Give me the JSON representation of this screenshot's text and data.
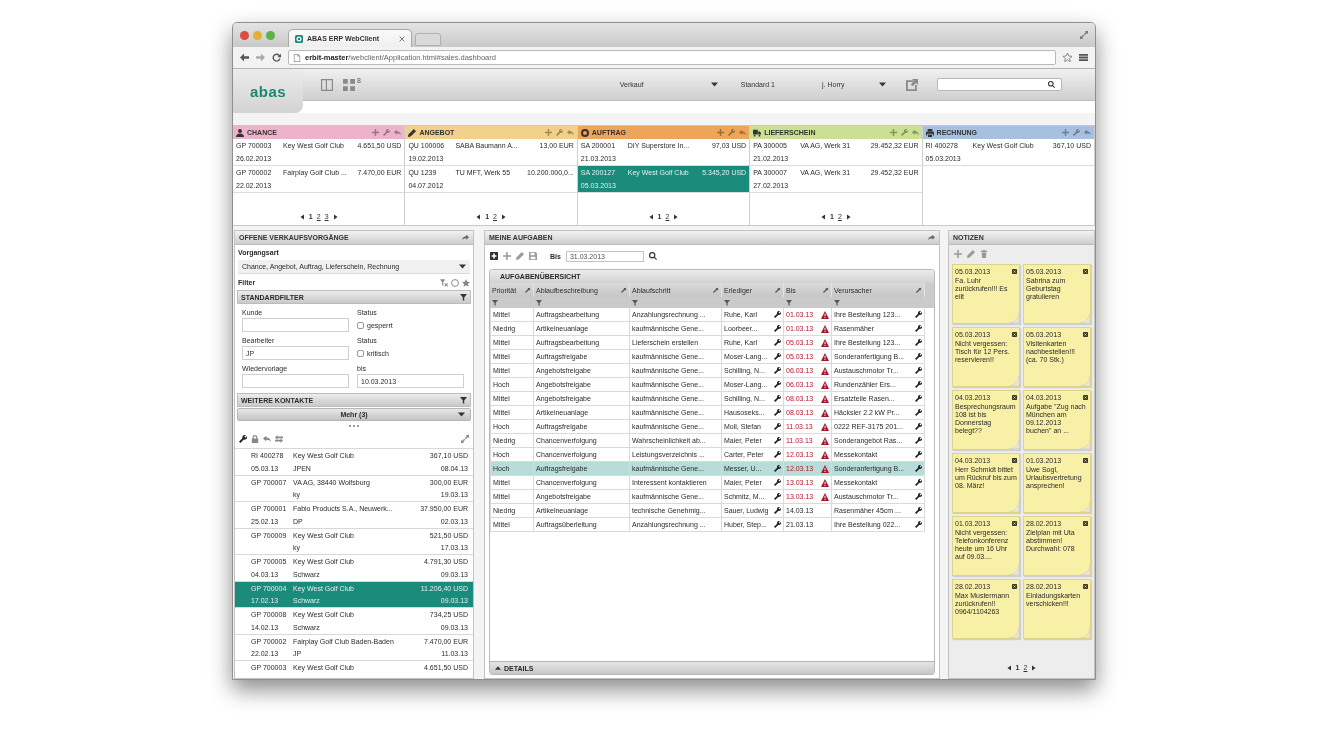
{
  "browser": {
    "tab_title": "ABAS ERP WebClient",
    "url": "**erbit-master**/webclient/Application.html#sales.dashboard"
  },
  "app_header": {
    "logo": "abas",
    "layout_count": "8",
    "module": "Verkauf",
    "layout_name": "Standard 1",
    "user": "j. Horry"
  },
  "pipeline": [
    {
      "title": "CHANCE",
      "color": "#efb3c9",
      "records": [
        {
          "number": "GP 700003",
          "customer": "Key West Golf Club",
          "amount": "4.651,50 USD",
          "date": "26.02.2013",
          "selected": false
        },
        {
          "number": "GP 700002",
          "customer": "Fairplay Golf Club ...",
          "amount": "7.470,00 EUR",
          "date": "22.02.2013",
          "selected": false
        }
      ],
      "pages": [
        {
          "label": "1",
          "selected": true
        },
        {
          "label": "2",
          "selected": false
        },
        {
          "label": "3",
          "selected": false
        }
      ]
    },
    {
      "title": "ANGEBOT",
      "color": "#f1d08a",
      "records": [
        {
          "number": "QU 100006",
          "customer": "SABA Baumann A...",
          "amount": "13,00 EUR",
          "date": "19.02.2013",
          "selected": false
        },
        {
          "number": "QU 1239",
          "customer": "TU MFT, Werk 55",
          "amount": "10.200.000,0...",
          "date": "04.07.2012",
          "selected": false
        }
      ],
      "pages": [
        {
          "label": "1",
          "selected": true
        },
        {
          "label": "2",
          "selected": false
        }
      ]
    },
    {
      "title": "AUFTRAG",
      "color": "#eea55a",
      "records": [
        {
          "number": "SA 200001",
          "customer": "DIY Superstore In...",
          "amount": "97,03 USD",
          "date": "21.03.2013",
          "selected": false
        },
        {
          "number": "SA 200127",
          "customer": "Key West Golf Club",
          "amount": "5.345,20 USD",
          "date": "05.03.2013",
          "selected": true
        }
      ],
      "pages": [
        {
          "label": "1",
          "selected": true
        },
        {
          "label": "2",
          "selected": false
        }
      ]
    },
    {
      "title": "LIEFERSCHEIN",
      "color": "#cbe092",
      "records": [
        {
          "number": "PA 300005",
          "customer": "VA AG, Werk 31",
          "amount": "29.452,32 EUR",
          "date": "21.02.2013",
          "selected": false
        },
        {
          "number": "PA 300007",
          "customer": "VA AG, Werk 31",
          "amount": "29.452,32 EUR",
          "date": "27.02.2013",
          "selected": false
        }
      ],
      "pages": [
        {
          "label": "1",
          "selected": true
        },
        {
          "label": "2",
          "selected": false
        }
      ]
    },
    {
      "title": "RECHNUNG",
      "color": "#a7c0df",
      "records": [
        {
          "number": "RI 400278",
          "customer": "Key West Golf Club",
          "amount": "367,10 USD",
          "date": "05.03.2013",
          "selected": false
        }
      ]
    }
  ],
  "open_sales": {
    "title": "OFFENE VERKAUFSVORGÄNGE",
    "type_label": "Vorgangsart",
    "type_value": "Chance, Angebot, Auftrag, Lieferschein, Rechnung",
    "filter_label": "Filter",
    "standard_filter_title": "STANDARDFILTER",
    "fields": [
      {
        "label": "Kunde",
        "kind": "text"
      },
      {
        "label": "Status",
        "kind": "checkbox",
        "option": "gesperrt",
        "checked": false
      },
      {
        "label": "Bearbeiter",
        "kind": "text",
        "value": "JP"
      },
      {
        "label": "Status",
        "kind": "checkbox",
        "option": "kritisch",
        "checked": false
      },
      {
        "label": "Wiedervorlage",
        "kind": "text"
      },
      {
        "label": "bis",
        "kind": "text",
        "value": "10.03.2013"
      }
    ],
    "contacts_title": "WEITERE KONTAKTE",
    "more_button": "Mehr (3)",
    "records": [
      {
        "number": "RI 400278",
        "name": "Key West Golf Club",
        "amount": "367,10 USD",
        "date": "05.03.13",
        "owner": "JPEN",
        "due": "08.04.13",
        "selected": false
      },
      {
        "number": "GP 700007",
        "name": "VA AG, 38440 Wolfsburg",
        "amount": "300,00 EUR",
        "owner": "ky",
        "due": "19.03.13",
        "selected": false
      },
      {
        "number": "GP 700001",
        "name": "Fabio Products S.A., Neuwerk...",
        "amount": "37.950,00 EUR",
        "date": "25.02.13",
        "owner": "DP",
        "due": "02.03.13",
        "selected": false
      },
      {
        "number": "GP 700009",
        "name": "Key West Golf Club",
        "amount": "521,50 USD",
        "owner": "ky",
        "due": "17.03.13",
        "selected": false
      },
      {
        "number": "GP 700005",
        "name": "Key West Golf Club",
        "amount": "4.791,30 USD",
        "date": "04.03.13",
        "owner": "Schwarz",
        "due": "09.03.13",
        "selected": false
      },
      {
        "number": "GP 700004",
        "name": "Key West Golf Club",
        "amount": "11.206,40 USD",
        "date": "17.02.13",
        "owner": "Schwarz",
        "due": "09.03.13",
        "selected": true
      },
      {
        "number": "GP 700008",
        "name": "Key West Golf Club",
        "amount": "734,25 USD",
        "date": "14.02.13",
        "owner": "Schwarz",
        "due": "09.03.13",
        "selected": false
      },
      {
        "number": "GP 700002",
        "name": "Fairplay Golf Club Baden-Baden",
        "amount": "7.470,00 EUR",
        "date": "22.02.13",
        "owner": "JP",
        "due": "11.03.13",
        "selected": false
      },
      {
        "number": "GP 700003",
        "name": "Key West Golf Club",
        "amount": "4.651,50 USD",
        "selected": false
      }
    ]
  },
  "tasks": {
    "title": "MEINE AUFGABEN",
    "until_label": "Bis",
    "until_value": "31.03.2013",
    "overview_title": "AUFGABENÜBERSICHT",
    "columns": [
      "Priorität",
      "Ablaufbeschreibung",
      "Ablaufschritt",
      "Erlediger",
      "Bis",
      "Verursacher"
    ],
    "rows": [
      {
        "priority": "Mittel",
        "process": "Auftragsbearbeitung",
        "step": "Anzahlungsrechnung ...",
        "assignee": "Ruhe, Karl",
        "due": "01.03.13",
        "overdue": true,
        "originator": "Ihre Bestellung 123...",
        "selected": false
      },
      {
        "priority": "Niedrig",
        "process": "Artikelneuanlage",
        "step": "kaufmännische Gene...",
        "assignee": "Loorbeer...",
        "due": "01.03.13",
        "overdue": true,
        "originator": "Rasenmäher",
        "selected": false
      },
      {
        "priority": "Mittel",
        "process": "Auftragsbearbeitung",
        "step": "Lieferschein erstellen",
        "assignee": "Ruhe, Karl",
        "due": "05.03.13",
        "overdue": true,
        "originator": "Ihre Bestellung 123...",
        "selected": false
      },
      {
        "priority": "Mittel",
        "process": "Auftragsfreigabe",
        "step": "kaufmännische Gene...",
        "assignee": "Moser-Lang...",
        "due": "05.03.13",
        "overdue": true,
        "originator": "Sonderanfertigung B...",
        "selected": false
      },
      {
        "priority": "Mittel",
        "process": "Angebotsfreigabe",
        "step": "kaufmännische Gene...",
        "assignee": "Schilling, N...",
        "due": "06.03.13",
        "overdue": true,
        "originator": "Austauschmotor Tr...",
        "selected": false
      },
      {
        "priority": "Hoch",
        "process": "Angebotsfreigabe",
        "step": "kaufmännische Gene...",
        "assignee": "Moser-Lang...",
        "due": "06.03.13",
        "overdue": true,
        "originator": "Rundenzähler Ers...",
        "selected": false
      },
      {
        "priority": "Mittel",
        "process": "Angebotsfreigabe",
        "step": "kaufmännische Gene...",
        "assignee": "Schilling, N...",
        "due": "08.03.13",
        "overdue": true,
        "originator": "Ersatzteile Rasen...",
        "selected": false
      },
      {
        "priority": "Mittel",
        "process": "Artikelneuanlage",
        "step": "kaufmännische Gene...",
        "assignee": "Hausoseks...",
        "due": "08.03.13",
        "overdue": true,
        "originator": "Häcksler 2.2 kW Pr...",
        "selected": false
      },
      {
        "priority": "Hoch",
        "process": "Auftragsfreigabe",
        "step": "kaufmännische Gene...",
        "assignee": "Moll, Stefan",
        "due": "11.03.13",
        "overdue": true,
        "originator": "0222 REF-3175 201...",
        "selected": false
      },
      {
        "priority": "Niedrig",
        "process": "Chancenverfolgung",
        "step": "Wahrscheinlichkeit ab...",
        "assignee": "Maier, Peter",
        "due": "11.03.13",
        "overdue": true,
        "originator": "Sonderangebot Ras...",
        "selected": false
      },
      {
        "priority": "Hoch",
        "process": "Chancenverfolgung",
        "step": "Leistungsverzeichnis ...",
        "assignee": "Carter, Peter",
        "due": "12.03.13",
        "overdue": true,
        "originator": "Messekontakt",
        "selected": false
      },
      {
        "priority": "Hoch",
        "process": "Auftragsfreigabe",
        "step": "kaufmännische Gene...",
        "assignee": "Messer, U...",
        "due": "12.03.13",
        "overdue": true,
        "originator": "Sonderanfertigung B...",
        "selected": true
      },
      {
        "priority": "Mittel",
        "process": "Chancenverfolgung",
        "step": "Interessent kontaktieren",
        "assignee": "Maier, Peter",
        "due": "13.03.13",
        "overdue": true,
        "originator": "Messekontakt",
        "selected": false
      },
      {
        "priority": "Mittel",
        "process": "Angebotsfreigabe",
        "step": "kaufmännische Gene...",
        "assignee": "Schmitz, M...",
        "due": "13.03.13",
        "overdue": true,
        "originator": "Austauschmotor Tr...",
        "selected": false
      },
      {
        "priority": "Niedrig",
        "process": "Artikelneuanlage",
        "step": "technische Genehmig...",
        "assignee": "Sauer, Ludwig",
        "due": "14.03.13",
        "overdue": false,
        "originator": "Rasenmäher 45cm ...",
        "selected": false
      },
      {
        "priority": "Mittel",
        "process": "Auftragsüberleitung",
        "step": "Anzahlungsrechnung ...",
        "assignee": "Huber, Step...",
        "due": "21.03.13",
        "overdue": false,
        "originator": "Ihre Bestellung 022...",
        "selected": false
      }
    ],
    "details_title": "DETAILS"
  },
  "notes": {
    "title": "NOTIZEN",
    "items": [
      {
        "date": "05.03.2013",
        "text": "Fa. Luhr zurückrufen!!! Es eilt"
      },
      {
        "date": "05.03.2013",
        "text": "Sabrina zum Geburtstag gratulieren"
      },
      {
        "date": "05.03.2013",
        "text": "Nicht vergessen: Tisch für 12 Pers. reservieren!!"
      },
      {
        "date": "05.03.2013",
        "text": "Visitenkarten nachbestellen!!! (ca. 70 Stk.)"
      },
      {
        "date": "04.03.2013",
        "text": "Besprechungsraum 108 ist bis Donnerstag belegt??"
      },
      {
        "date": "04.03.2013",
        "text": "Aufgabe \"Zug nach München am 09.12.2013 buchen\" an ..."
      },
      {
        "date": "04.03.2013",
        "text": "Herr Schmidt bittet um Rückruf bis zum 08. März!"
      },
      {
        "date": "01.03.2013",
        "text": "Uwe Sogl, Urlaubsvertretung ansprechen!"
      },
      {
        "date": "01.03.2013",
        "text": "Nicht vergessen: Telefonkonferenz heute um 16 Uhr auf 09.03...."
      },
      {
        "date": "28.02.2013",
        "text": "Zielplan mit Uta abstimmen! Durchwahl: 078"
      },
      {
        "date": "28.02.2013",
        "text": "Max Mustermann zurückrufen!! 0964/1104263"
      },
      {
        "date": "28.02.2013",
        "text": "Einladungskarten verschicken!!!"
      }
    ],
    "pages": [
      {
        "label": "1",
        "selected": true
      },
      {
        "label": "2",
        "selected": false
      }
    ]
  }
}
